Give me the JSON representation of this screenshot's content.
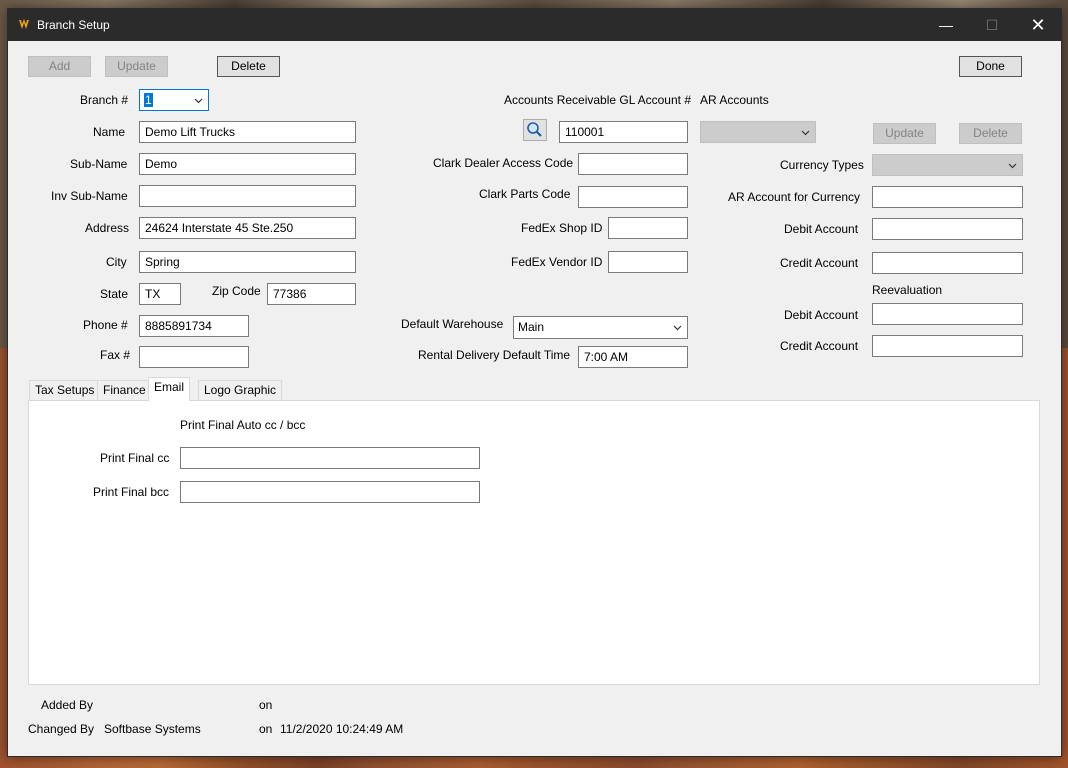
{
  "window": {
    "title": "Branch Setup"
  },
  "toolbar": {
    "add": "Add",
    "update": "Update",
    "delete": "Delete",
    "done": "Done"
  },
  "branch": {
    "branch_label": "Branch #",
    "branch_value": "1",
    "name_label": "Name",
    "name_value": "Demo Lift Trucks",
    "subname_label": "Sub-Name",
    "subname_value": "Demo",
    "inv_subname_label": "Inv Sub-Name",
    "inv_subname_value": "",
    "address_label": "Address",
    "address_value": "24624 Interstate 45 Ste.250",
    "city_label": "City",
    "city_value": "Spring",
    "state_label": "State",
    "state_value": "TX",
    "zip_label": "Zip Code",
    "zip_value": "77386",
    "phone_label": "Phone #",
    "phone_value": "8885891734",
    "fax_label": "Fax #",
    "fax_value": ""
  },
  "middle": {
    "ar_gl_label": "Accounts Receivable GL Account #",
    "ar_gl_value": "110001",
    "clark_dealer_label": "Clark Dealer Access Code",
    "clark_dealer_value": "",
    "clark_parts_label": "Clark Parts Code",
    "clark_parts_value": "",
    "fedex_shop_label": "FedEx Shop ID",
    "fedex_shop_value": "",
    "fedex_vendor_label": "FedEx Vendor ID",
    "fedex_vendor_value": "",
    "warehouse_label": "Default Warehouse",
    "warehouse_value": "Main",
    "rental_label": "Rental Delivery Default Time",
    "rental_value": "7:00 AM"
  },
  "ar_accounts": {
    "title": "AR Accounts",
    "update": "Update",
    "delete": "Delete",
    "currency_types_label": "Currency Types",
    "ar_currency_label": "AR Account for Currency",
    "ar_currency_value": "",
    "debit_label": "Debit Account",
    "debit_value": "",
    "credit_label": "Credit Account",
    "credit_value": "",
    "reevaluation_label": "Reevaluation",
    "re_debit_label": "Debit Account",
    "re_debit_value": "",
    "re_credit_label": "Credit Account",
    "re_credit_value": ""
  },
  "tabs": [
    "Tax Setups",
    "Finance",
    "Email",
    "Logo Graphic"
  ],
  "email_tab": {
    "heading": "Print Final Auto cc / bcc",
    "cc_label": "Print Final cc",
    "cc_value": "",
    "bcc_label": "Print Final bcc",
    "bcc_value": ""
  },
  "footer": {
    "added_by_label": "Added By",
    "added_by_value": "",
    "added_on_label": "on",
    "added_on_value": "",
    "changed_by_label": "Changed By",
    "changed_by_value": "Softbase Systems",
    "changed_on_label": "on",
    "changed_on_value": "11/2/2020 10:24:49 AM"
  },
  "colors": {
    "titlebar": "#2b2b2b",
    "selection": "#0078d7",
    "window_bg": "#f0f0f0"
  }
}
